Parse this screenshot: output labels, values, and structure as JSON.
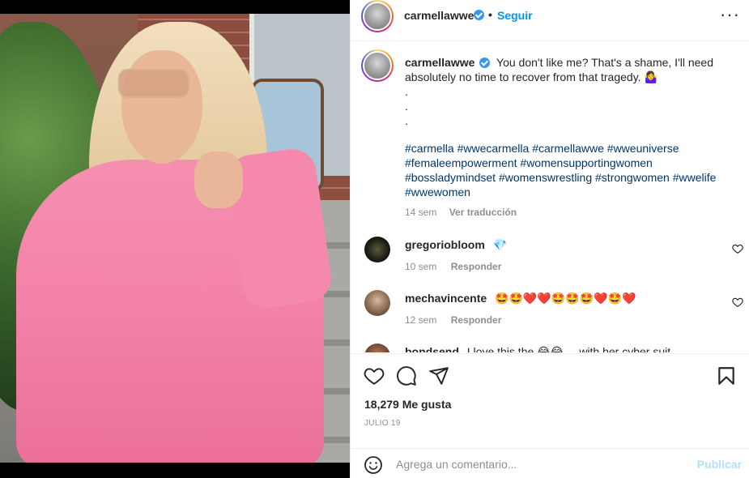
{
  "post": {
    "username": "carmellawwe",
    "follow_label": "Seguir",
    "separator": "•",
    "more_label": "···"
  },
  "caption": {
    "username": "carmellawwe",
    "text": "You don't like me? That's a shame, I'll need absolutely no time to recover from that tragedy. 🤷‍♀️",
    "dots": ".",
    "hashtags": [
      "#carmella",
      "#wwecarmella",
      "#carmellawwe",
      "#wweuniverse",
      "#femaleempowerment",
      "#womensupportingwomen",
      "#bossladymindset",
      "#womenswrestling",
      "#strongwomen",
      "#wwelife",
      "#wwewomen"
    ],
    "time": "14 sem",
    "translate_label": "Ver traducción"
  },
  "comments": [
    {
      "username": "gregoriobloom",
      "text": "💎",
      "time": "10 sem",
      "reply_label": "Responder"
    },
    {
      "username": "mechavincente",
      "text": "🤩🤩❤️❤️🤩🤩🤩❤️🤩❤️",
      "time": "12 sem",
      "reply_label": "Responder"
    },
    {
      "username": "bondsend",
      "text": "I love this the 😂😂 ... with her cyber suit",
      "time": "",
      "reply_label": ""
    }
  ],
  "stats": {
    "likes": "18,279 Me gusta",
    "date": "JULIO 19"
  },
  "composer": {
    "placeholder": "Agrega un comentario...",
    "publish_label": "Publicar"
  },
  "colors": {
    "link_blue": "#0095f6",
    "hashtag": "#00376b",
    "muted": "#8e8e8e",
    "publish_disabled": "#b2dffc"
  },
  "icons": {
    "like": "heart-icon",
    "comment": "comment-icon",
    "share": "send-icon",
    "save": "bookmark-icon",
    "emoji": "emoji-icon",
    "options": "more-icon"
  }
}
